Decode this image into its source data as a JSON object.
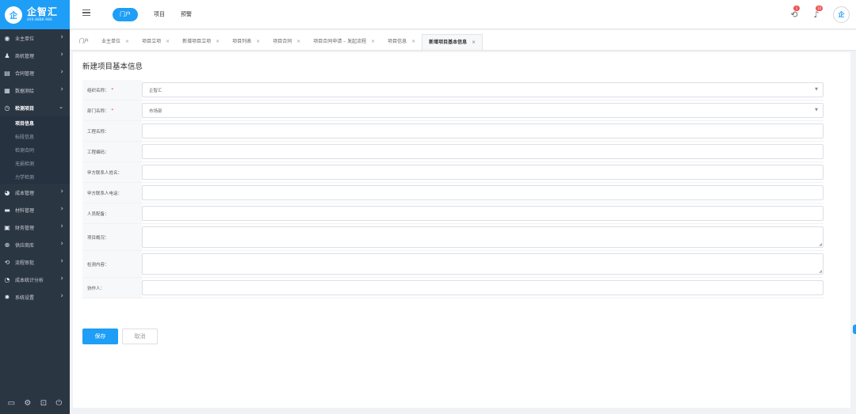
{
  "app": {
    "logo_mark": "企",
    "logo_title": "企智汇",
    "logo_phone": "400-8886-986"
  },
  "sidebar": {
    "items": [
      {
        "label": "业主单位",
        "icon": "user-circle-icon",
        "glyph": "◉"
      },
      {
        "label": "商机管理",
        "icon": "users-icon",
        "glyph": "👥"
      },
      {
        "label": "合同管理",
        "icon": "document-icon",
        "glyph": "▤"
      },
      {
        "label": "数据测绘",
        "icon": "table-icon",
        "glyph": "▦"
      },
      {
        "label": "检测项目",
        "icon": "clock-icon",
        "glyph": "◷"
      }
    ],
    "subitems": [
      {
        "label": "项目信息",
        "active": true
      },
      {
        "label": "标段信息",
        "active": false
      },
      {
        "label": "检测合同",
        "active": false
      },
      {
        "label": "无损检测",
        "active": false
      },
      {
        "label": "力学检测",
        "active": false
      }
    ],
    "items_after": [
      {
        "label": "成本管理",
        "icon": "pie-chart-icon",
        "glyph": "◕"
      },
      {
        "label": "材料管理",
        "icon": "folder-icon",
        "glyph": "▬"
      },
      {
        "label": "财务管理",
        "icon": "wallet-icon",
        "glyph": "▣"
      },
      {
        "label": "供应商库",
        "icon": "globe-icon",
        "glyph": "⊕"
      },
      {
        "label": "流程审批",
        "icon": "refresh-icon",
        "glyph": "⟲"
      },
      {
        "label": "成本统计分析",
        "icon": "pie-chart-icon",
        "glyph": "◔"
      },
      {
        "label": "系统设置",
        "icon": "gear-icon",
        "glyph": "✹"
      }
    ],
    "footer_icons": [
      {
        "name": "monitor-icon",
        "glyph": "▭"
      },
      {
        "name": "gear-icon",
        "glyph": "⚙"
      },
      {
        "name": "lock-icon",
        "glyph": "🔒"
      },
      {
        "name": "power-icon",
        "glyph": "⏻"
      }
    ]
  },
  "topnav": {
    "items": [
      {
        "label": "门户",
        "active": true
      },
      {
        "label": "项目",
        "active": false
      },
      {
        "label": "预警",
        "active": false
      }
    ],
    "badges": {
      "sync": "1",
      "notify": "10"
    },
    "avatar_text": "企"
  },
  "tabs": [
    {
      "label": "门户",
      "closable": false,
      "active": false
    },
    {
      "label": "业主单位",
      "closable": true,
      "active": false
    },
    {
      "label": "项目立项",
      "closable": true,
      "active": false
    },
    {
      "label": "新增项目立项",
      "closable": true,
      "active": false
    },
    {
      "label": "项目列表",
      "closable": true,
      "active": false
    },
    {
      "label": "项目合同",
      "closable": true,
      "active": false
    },
    {
      "label": "项目合同申请 – 发起流程",
      "closable": true,
      "active": false
    },
    {
      "label": "项目信息",
      "closable": true,
      "active": false
    },
    {
      "label": "新增项目基本信息",
      "closable": true,
      "active": true
    }
  ],
  "page": {
    "title": "新建项目基本信息"
  },
  "form": {
    "fields": [
      {
        "label": "组织名称：",
        "required": true,
        "type": "select",
        "value": "企智汇"
      },
      {
        "label": "部门名称：",
        "required": true,
        "type": "select",
        "value": "市场部"
      },
      {
        "label": "工程名称：",
        "required": false,
        "type": "input",
        "value": ""
      },
      {
        "label": "工程编码：",
        "required": false,
        "type": "input",
        "value": ""
      },
      {
        "label": "甲方联系人姓名：",
        "required": false,
        "type": "input",
        "value": ""
      },
      {
        "label": "甲方联系人电话：",
        "required": false,
        "type": "input",
        "value": ""
      },
      {
        "label": "人员配备：",
        "required": false,
        "type": "input",
        "value": ""
      },
      {
        "label": "项目概况：",
        "required": false,
        "type": "textarea",
        "value": ""
      },
      {
        "label": "检测内容：",
        "required": false,
        "type": "textarea",
        "value": ""
      },
      {
        "label": "协作人：",
        "required": false,
        "type": "input",
        "value": ""
      }
    ],
    "required_mark": "*",
    "save_label": "保存",
    "cancel_label": "取消"
  },
  "colors": {
    "accent": "#1e9ef6",
    "sidebar_bg": "#2b3643",
    "badge": "#ef5350",
    "required": "#e53935"
  }
}
